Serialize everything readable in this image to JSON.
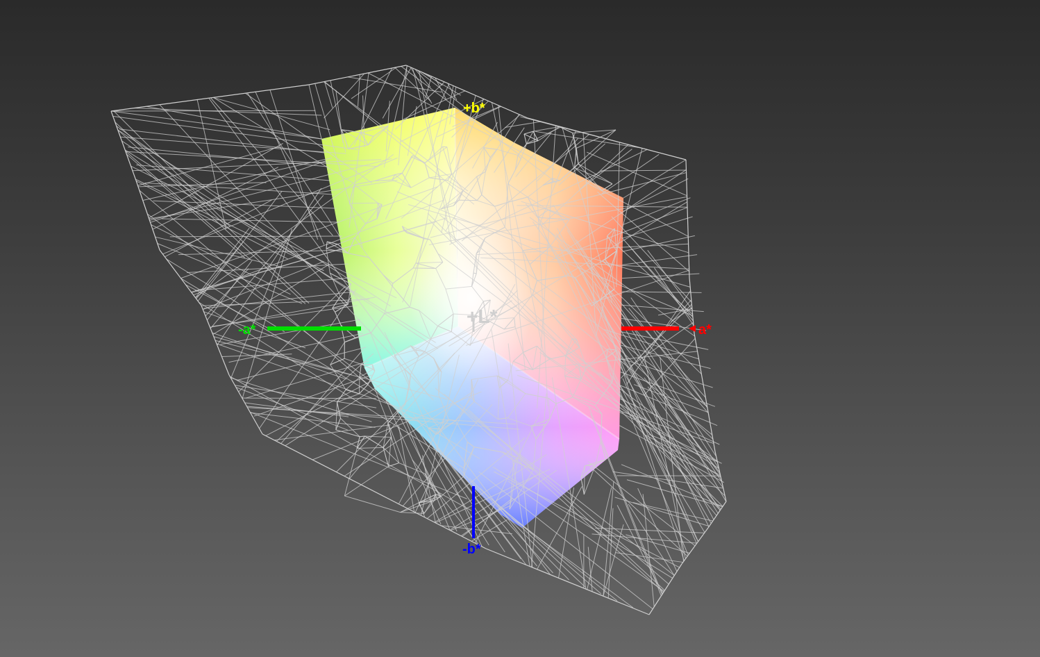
{
  "viewer": {
    "axes": {
      "plus_b": {
        "label": "+b*",
        "color": "#ffff00"
      },
      "minus_b": {
        "label": "-b*",
        "color": "#0000ff"
      },
      "plus_a": {
        "label": "a*",
        "color": "#ff0000"
      },
      "minus_a": {
        "label": "-a*",
        "color": "#00dd00"
      },
      "plus_l": {
        "label": "+L*",
        "color": "#cfcfcf"
      }
    },
    "colors": {
      "wireframe": "#d0d0d0",
      "background_top": "#2a2a2a",
      "background_bottom": "#666666"
    },
    "gamut_faces": [
      "yellow-green",
      "yellow-orange",
      "cyan-blue-magenta"
    ]
  }
}
